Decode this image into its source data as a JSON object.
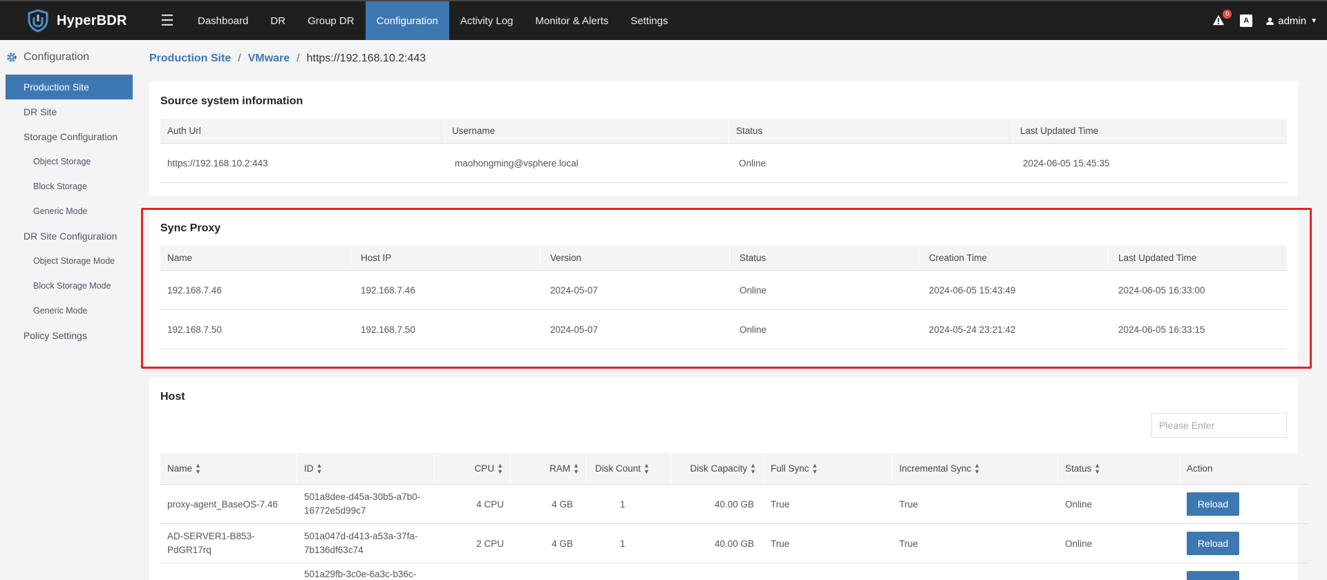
{
  "app": {
    "name": "HyperBDR"
  },
  "nav": {
    "items": [
      "Dashboard",
      "DR",
      "Group DR",
      "Configuration",
      "Activity Log",
      "Monitor & Alerts",
      "Settings"
    ],
    "alert_count": "0",
    "lang_label": "A",
    "user": "admin"
  },
  "sidebar": {
    "header": "Configuration",
    "items": [
      {
        "label": "Production Site"
      },
      {
        "label": "DR Site"
      },
      {
        "label": "Storage Configuration"
      },
      {
        "label": "Object Storage"
      },
      {
        "label": "Block Storage"
      },
      {
        "label": "Generic Mode"
      },
      {
        "label": "DR Site Configuration"
      },
      {
        "label": "Object Storage Mode"
      },
      {
        "label": "Block Storage Mode"
      },
      {
        "label": "Generic Mode"
      },
      {
        "label": "Policy Settings"
      }
    ]
  },
  "breadcrumb": {
    "first": "Production Site",
    "second": "VMware",
    "current": "https://192.168.10.2:443",
    "sep": "/"
  },
  "source": {
    "title": "Source system information",
    "columns": [
      "Auth Url",
      "Username",
      "Status",
      "Last Updated Time"
    ],
    "row": [
      "https://192.168.10.2:443",
      "maohongming@vsphere.local",
      "Online",
      "2024-06-05 15:45:35"
    ]
  },
  "proxy": {
    "title": "Sync Proxy",
    "columns": [
      "Name",
      "Host IP",
      "Version",
      "Status",
      "Creation Time",
      "Last Updated Time"
    ],
    "rows": [
      [
        "192.168.7.46",
        "192.168.7.46",
        "2024-05-07",
        "Online",
        "2024-06-05 15:43:49",
        "2024-06-05 16:33:00"
      ],
      [
        "192.168.7.50",
        "192.168.7.50",
        "2024-05-07",
        "Online",
        "2024-05-24 23:21:42",
        "2024-06-05 16:33:15"
      ]
    ]
  },
  "host": {
    "title": "Host",
    "search_placeholder": "Please Enter",
    "columns": [
      "Name",
      "ID",
      "CPU",
      "RAM",
      "Disk Count",
      "Disk Capacity",
      "Full Sync",
      "Incremental Sync",
      "Status",
      "Action"
    ],
    "rows": [
      {
        "name": "proxy-agent_BaseOS-7.46",
        "id1": "501a8dee-d45a-30b5-a7b0-",
        "id2": "16772e5d99c7",
        "cpu": "4 CPU",
        "ram": "4 GB",
        "disks": "1",
        "cap": "40.00 GB",
        "full": "True",
        "inc": "True",
        "status": "Online",
        "action": "Reload"
      },
      {
        "name": "AD-SERVER1-B853-",
        "name2": "PdGR17rq",
        "id1": "501a047d-d413-a53a-37fa-",
        "id2": "7b136df63c74",
        "cpu": "2 CPU",
        "ram": "4 GB",
        "disks": "1",
        "cap": "40.00 GB",
        "full": "True",
        "inc": "True",
        "status": "Online",
        "action": "Reload"
      },
      {
        "id1": "501a29fb-3c0e-6a3c-b36c-"
      }
    ]
  }
}
